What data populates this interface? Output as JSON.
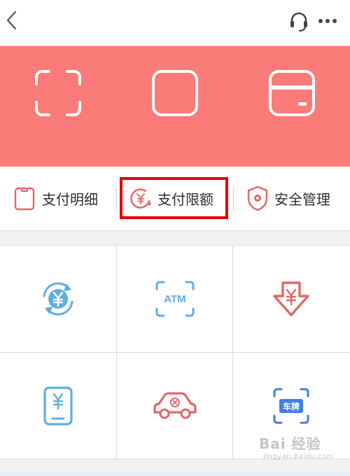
{
  "header": {
    "back_icon": "chevron-left-icon",
    "support_icon": "headset-icon",
    "more_icon": "ellipsis-icon"
  },
  "hero": {
    "background": "#fb7b78",
    "actions": [
      {
        "icon": "scan-icon"
      },
      {
        "icon": "square-icon"
      },
      {
        "icon": "card-icon"
      }
    ]
  },
  "shortcuts": [
    {
      "label": "支付明细",
      "icon": "receipt-icon"
    },
    {
      "label": "支付限额",
      "icon": "yen-limit-icon",
      "highlighted": true
    },
    {
      "label": "安全管理",
      "icon": "shield-icon"
    }
  ],
  "grid": [
    {
      "icon": "yen-exchange-icon",
      "color": "#5eaee0"
    },
    {
      "icon": "atm-icon",
      "text": "ATM",
      "color": "#5eaee0"
    },
    {
      "icon": "yen-down-arrow-icon",
      "color": "#e06868"
    },
    {
      "icon": "phone-yen-icon",
      "color": "#5eaee0"
    },
    {
      "icon": "car-icon",
      "color": "#e06868"
    },
    {
      "icon": "license-plate-icon",
      "text": "车牌",
      "color": "#3f7fe6"
    }
  ],
  "watermark": {
    "main": "Bai 经验",
    "sub": "jingyan.baidu.com"
  }
}
